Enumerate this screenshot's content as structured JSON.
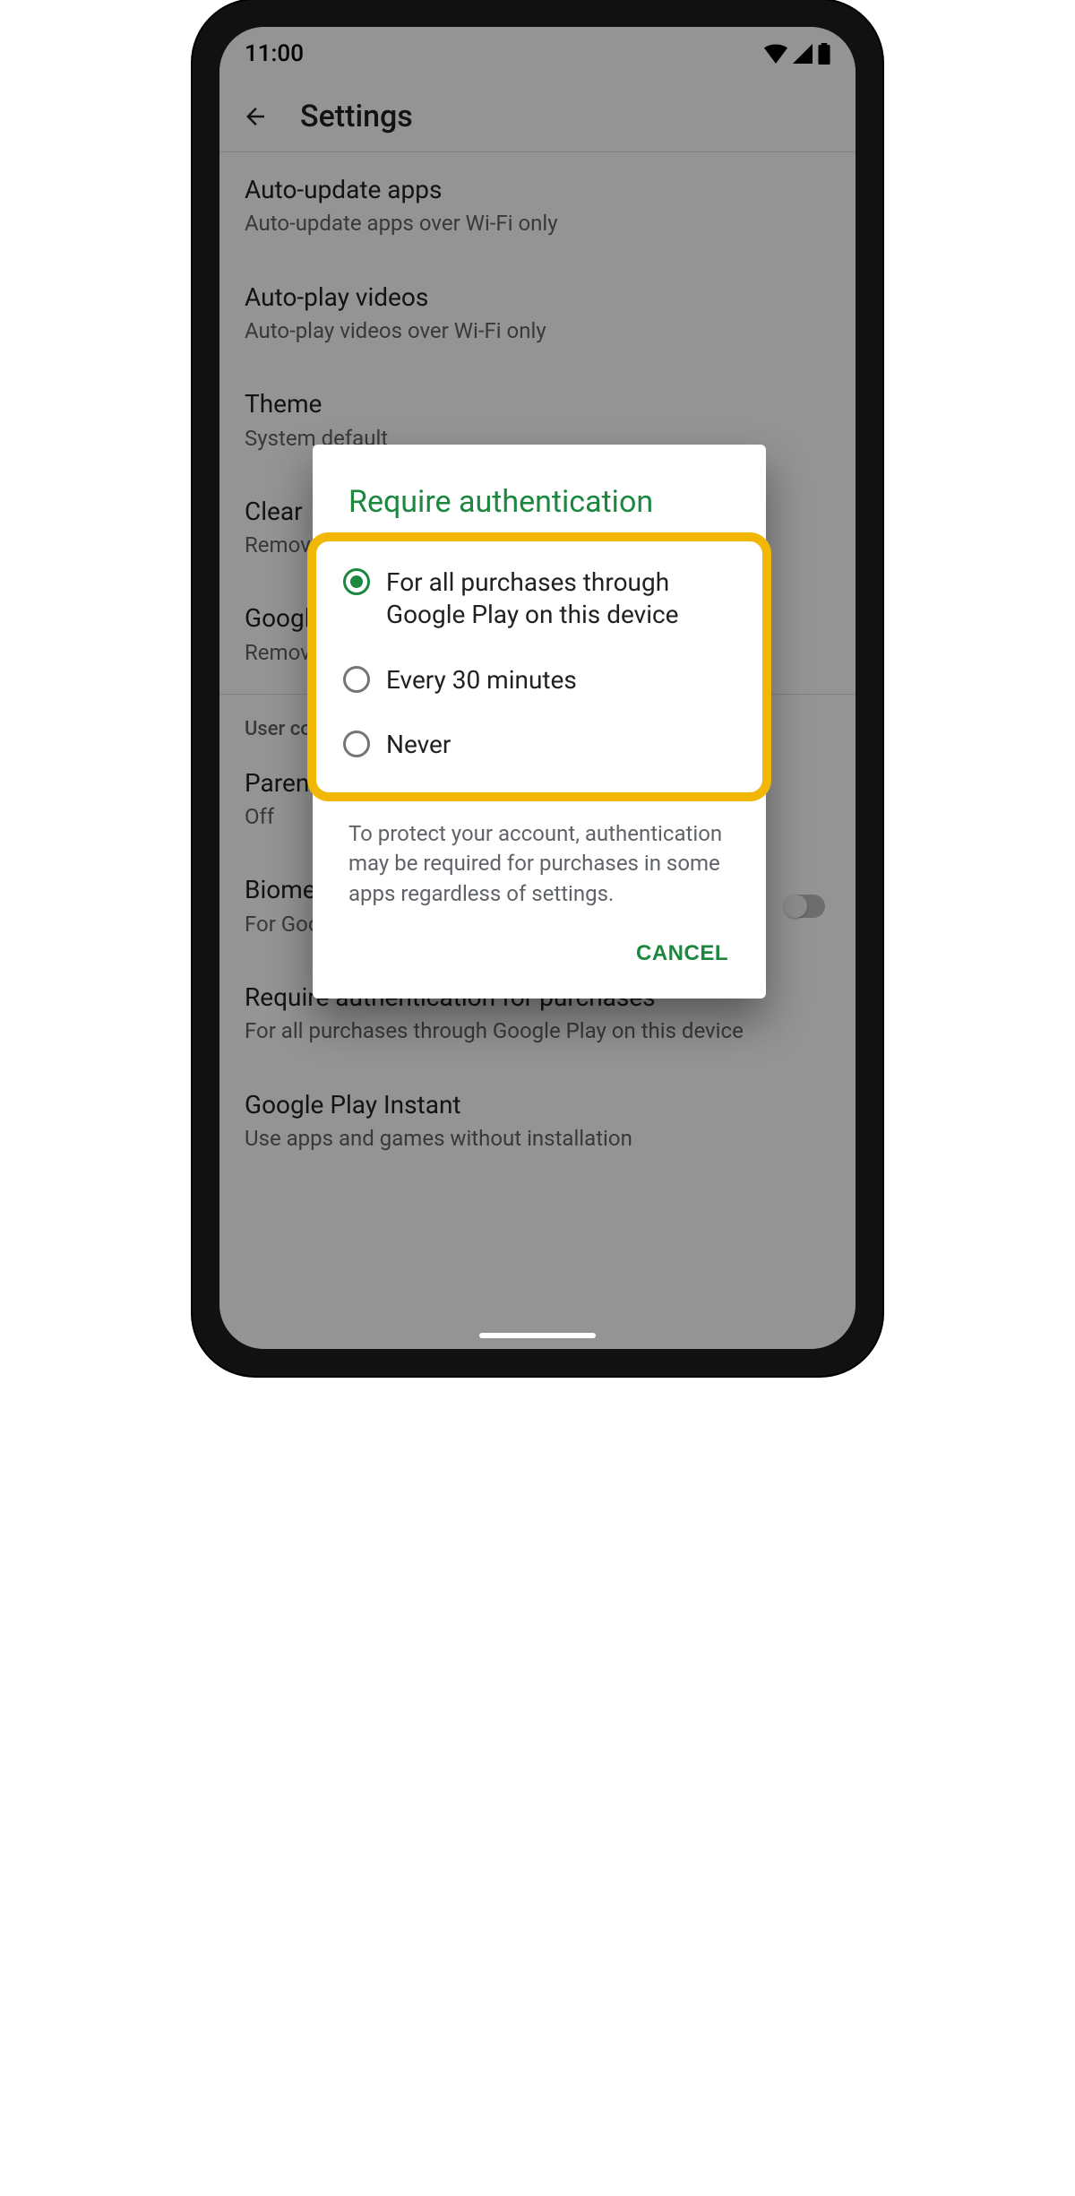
{
  "statusbar": {
    "time": "11:00"
  },
  "appbar": {
    "title": "Settings"
  },
  "settings": {
    "items": [
      {
        "title": "Auto-update apps",
        "sub": "Auto-update apps over Wi-Fi only"
      },
      {
        "title": "Auto-play videos",
        "sub": "Auto-play videos over Wi-Fi only"
      },
      {
        "title": "Theme",
        "sub": "System default"
      },
      {
        "title": "Clear",
        "sub": "Remove"
      },
      {
        "title": "Google",
        "sub": "Remove and other"
      }
    ],
    "section_header": "User controls",
    "user_items": [
      {
        "title": "Parental controls",
        "sub": "Off"
      },
      {
        "title": "Biometric authentication",
        "sub": "For Google Play purchases on this device"
      },
      {
        "title": "Require authentication for purchases",
        "sub": "For all purchases through Google Play on this device"
      },
      {
        "title": "Google Play Instant",
        "sub": "Use apps and games without installation"
      }
    ]
  },
  "dialog": {
    "title": "Require authentication",
    "options": [
      "For all purchases through Google Play on this device",
      "Every 30 minutes",
      "Never"
    ],
    "selected_index": 0,
    "note": "To protect your account, authentication may be required for purchases in some apps regardless of settings.",
    "cancel": "CANCEL"
  }
}
